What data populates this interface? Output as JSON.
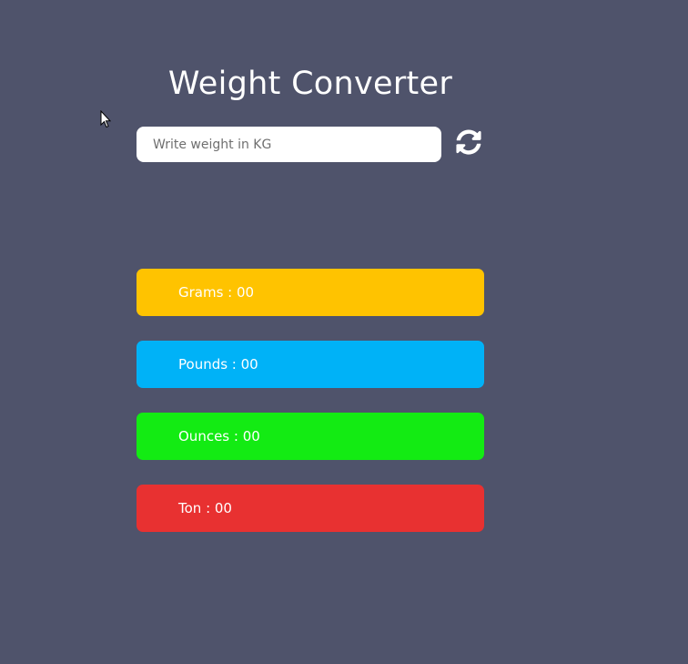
{
  "app": {
    "title": "Weight Converter"
  },
  "input": {
    "placeholder": "Write weight in KG",
    "value": ""
  },
  "controls": {
    "reset_icon": "refresh-icon"
  },
  "results": {
    "grams": "Grams : 00",
    "pounds": "Pounds : 00",
    "ounces": "Ounces : 00",
    "ton": "Ton : 00"
  },
  "colors": {
    "background": "#4f536b",
    "grams": "#ffc300",
    "pounds": "#00b2f7",
    "ounces": "#13eb13",
    "ton": "#e83131"
  }
}
